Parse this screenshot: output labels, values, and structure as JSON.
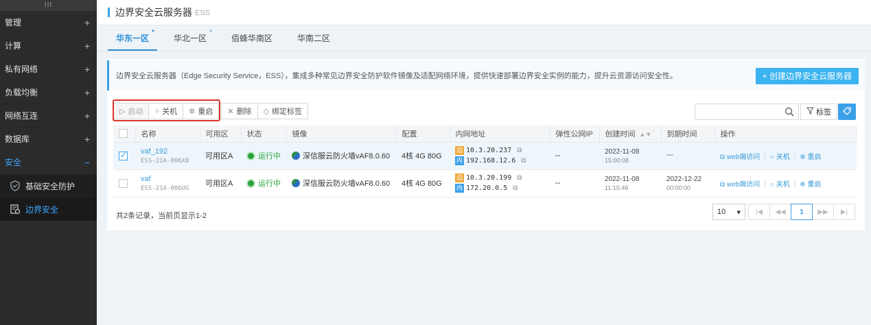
{
  "sidebar": {
    "handle": "III",
    "items": [
      {
        "label": "管理",
        "toggle": "+"
      },
      {
        "label": "计算",
        "toggle": "+"
      },
      {
        "label": "私有网络",
        "toggle": "+"
      },
      {
        "label": "负载均衡",
        "toggle": "+"
      },
      {
        "label": "网络互连",
        "toggle": "+"
      },
      {
        "label": "数据库",
        "toggle": "+"
      },
      {
        "label": "安全",
        "toggle": "−"
      }
    ],
    "sub_items": [
      {
        "label": "基础安全防护",
        "icon": "shield-check-icon"
      },
      {
        "label": "边界安全",
        "icon": "border-security-icon"
      }
    ],
    "active_color": "#3ea6ff"
  },
  "header": {
    "title": "边界安全云服务器",
    "subtitle": "ESS"
  },
  "tabs": [
    {
      "label": "华东一区",
      "marker": "*"
    },
    {
      "label": "华北一区",
      "marker": "*"
    },
    {
      "label": "佰蜂华南区",
      "marker": ""
    },
    {
      "label": "华南二区",
      "marker": ""
    }
  ],
  "info": {
    "text": "边界安全云服务器（Edge Security Service，ESS），集成多种常见边界安全防护软件镜像及适配网络环境，提供快速部署边界安全实例的能力，提升云资源访问安全性。",
    "create_button": "+ 创建边界安全云服务器"
  },
  "toolbar": {
    "start": "启动",
    "shutdown": "关机",
    "restart": "重启",
    "delete": "删除",
    "bind_tag": "绑定标签",
    "tag": "标签",
    "search_placeholder": ""
  },
  "table": {
    "headers": [
      "名称",
      "可用区",
      "状态",
      "镜像",
      "配置",
      "内网地址",
      "弹性公网IP",
      "创建时间",
      "到期时间",
      "操作"
    ],
    "rows": [
      {
        "checked": true,
        "name": "vaf_192",
        "id": "ESS-21A-006X8",
        "zone": "可用区A",
        "status": "运行中",
        "image": "深信服云防火墙vAF8.0.60",
        "config": "4核 4G 80G",
        "ip_edge_tag": "边",
        "ip_edge": "10.3.20.237",
        "ip_inner_tag": "内",
        "ip_inner": "192.168.12.6",
        "eip": "--",
        "created_date": "2022-11-08",
        "created_time": "15:00:08",
        "expire_date": "---",
        "expire_time": "",
        "op_web": "web端访问",
        "op_shutdown": "关机",
        "op_restart": "重启"
      },
      {
        "checked": false,
        "name": "vaf",
        "id": "ESS-21A-006UG",
        "zone": "可用区A",
        "status": "运行中",
        "image": "深信服云防火墙vAF8.0.60",
        "config": "4核 4G 80G",
        "ip_edge_tag": "边",
        "ip_edge": "10.3.20.199",
        "ip_inner_tag": "内",
        "ip_inner": "172.20.0.5",
        "eip": "--",
        "created_date": "2022-11-08",
        "created_time": "11:15:46",
        "expire_date": "2022-12-22",
        "expire_time": "00:00:00",
        "op_web": "web端访问",
        "op_shutdown": "关机",
        "op_restart": "重启"
      }
    ]
  },
  "footer": {
    "summary": "共2条记录，当前页显示1-2",
    "page_size": "10",
    "current_page": "1"
  },
  "colors": {
    "accent": "#3aa0e8",
    "running": "#2aa43a",
    "highlight": "#d9342b"
  }
}
